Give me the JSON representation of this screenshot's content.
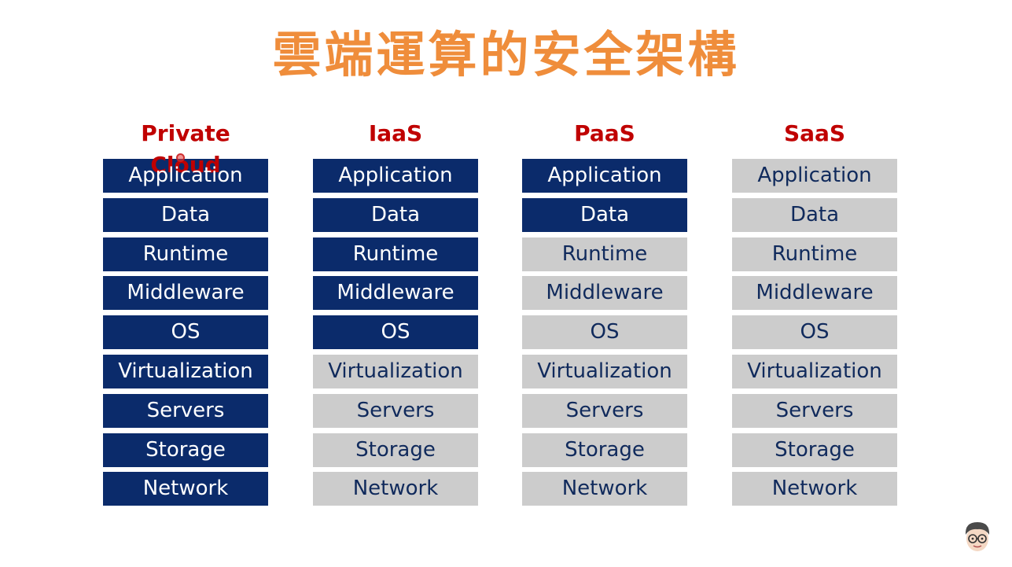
{
  "title": "雲端運算的安全架構",
  "colors": {
    "title": "#ef8d3b",
    "heading": "#c00000",
    "managed_fill": "#0b2b6b",
    "managed_text": "#ffffff",
    "provider_fill": "#cccccc",
    "provider_text": "#102a5c"
  },
  "columns": [
    {
      "heading": "Private Cloud",
      "layers": [
        {
          "label": "Application",
          "managed": true
        },
        {
          "label": "Data",
          "managed": true
        },
        {
          "label": "Runtime",
          "managed": true
        },
        {
          "label": "Middleware",
          "managed": true
        },
        {
          "label": "OS",
          "managed": true
        },
        {
          "label": "Virtualization",
          "managed": true
        },
        {
          "label": "Servers",
          "managed": true
        },
        {
          "label": "Storage",
          "managed": true
        },
        {
          "label": "Network",
          "managed": true
        }
      ]
    },
    {
      "heading": "IaaS",
      "layers": [
        {
          "label": "Application",
          "managed": true
        },
        {
          "label": "Data",
          "managed": true
        },
        {
          "label": "Runtime",
          "managed": true
        },
        {
          "label": "Middleware",
          "managed": true
        },
        {
          "label": "OS",
          "managed": true
        },
        {
          "label": "Virtualization",
          "managed": false
        },
        {
          "label": "Servers",
          "managed": false
        },
        {
          "label": "Storage",
          "managed": false
        },
        {
          "label": "Network",
          "managed": false
        }
      ]
    },
    {
      "heading": "PaaS",
      "layers": [
        {
          "label": "Application",
          "managed": true
        },
        {
          "label": "Data",
          "managed": true
        },
        {
          "label": "Runtime",
          "managed": false
        },
        {
          "label": "Middleware",
          "managed": false
        },
        {
          "label": "OS",
          "managed": false
        },
        {
          "label": "Virtualization",
          "managed": false
        },
        {
          "label": "Servers",
          "managed": false
        },
        {
          "label": "Storage",
          "managed": false
        },
        {
          "label": "Network",
          "managed": false
        }
      ]
    },
    {
      "heading": "SaaS",
      "layers": [
        {
          "label": "Application",
          "managed": false
        },
        {
          "label": "Data",
          "managed": false
        },
        {
          "label": "Runtime",
          "managed": false
        },
        {
          "label": "Middleware",
          "managed": false
        },
        {
          "label": "OS",
          "managed": false
        },
        {
          "label": "Virtualization",
          "managed": false
        },
        {
          "label": "Servers",
          "managed": false
        },
        {
          "label": "Storage",
          "managed": false
        },
        {
          "label": "Network",
          "managed": false
        }
      ]
    }
  ],
  "avatar_icon": "cartoon-avatar-icon",
  "cursor_icon": "pointer-dot-icon"
}
